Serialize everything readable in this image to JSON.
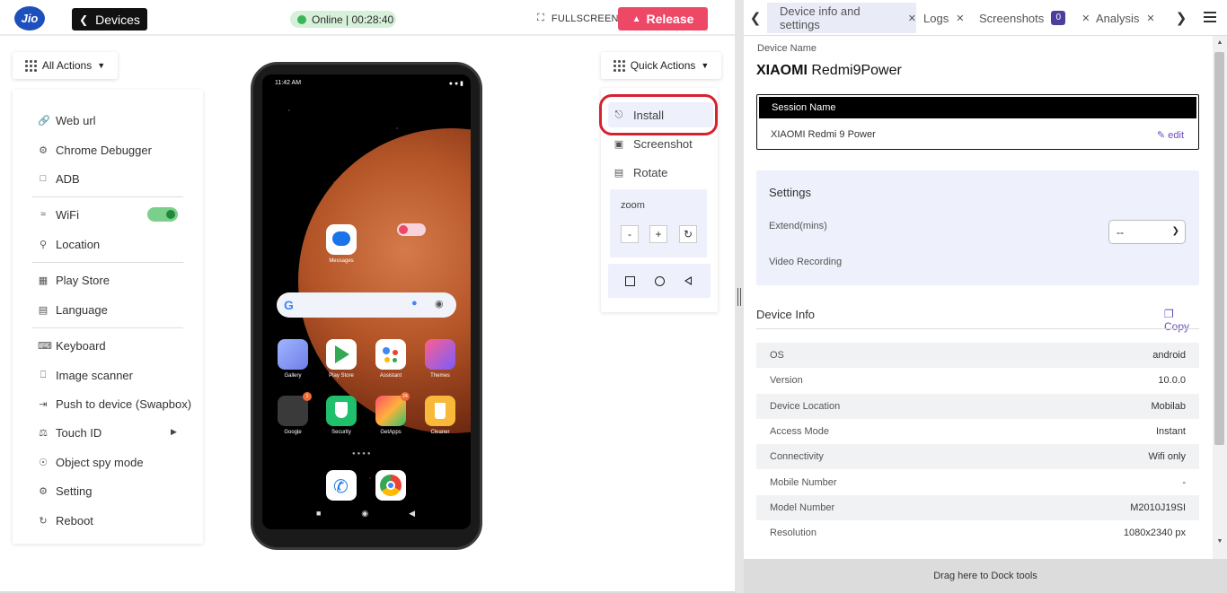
{
  "topbar": {
    "logo_text": "Jio",
    "devices_label": "Devices",
    "status": "Online | 00:28:40",
    "fullscreen_label": "FULLSCREEN",
    "release_label": "Release"
  },
  "all_actions": {
    "label": "All Actions",
    "items": [
      {
        "label": "Web url",
        "icon": "link-icon"
      },
      {
        "label": "Chrome Debugger",
        "icon": "bug-icon"
      },
      {
        "label": "ADB",
        "icon": "terminal-icon"
      },
      {
        "label": "WiFi",
        "icon": "wifi-icon",
        "toggle": "on"
      },
      {
        "label": "Location",
        "icon": "location-pin-icon"
      },
      {
        "label": "Play Store",
        "icon": "grid-icon"
      },
      {
        "label": "Language",
        "icon": "language-icon"
      },
      {
        "label": "Keyboard",
        "icon": "keyboard-icon"
      },
      {
        "label": "Image scanner",
        "icon": "image-scanner-icon"
      },
      {
        "label": "Push to device (Swapbox)",
        "icon": "push-icon"
      },
      {
        "label": "Touch ID",
        "icon": "fingerprint-icon"
      },
      {
        "label": "Object spy mode",
        "icon": "spy-icon"
      },
      {
        "label": "Setting",
        "icon": "gear-icon"
      },
      {
        "label": "Reboot",
        "icon": "reboot-icon"
      }
    ]
  },
  "phone": {
    "time": "11:42 AM",
    "apps_top": [
      {
        "label": "Messages"
      }
    ],
    "apps_row1": [
      {
        "label": "Gallery",
        "color": "#7b8cf2"
      },
      {
        "label": "Play Store",
        "color": "#ffffff"
      },
      {
        "label": "Assistant",
        "color": "#ffffff"
      },
      {
        "label": "Themes",
        "color": "#f5447c"
      }
    ],
    "apps_row2": [
      {
        "label": "Google",
        "color": "#3a3a3a",
        "badge": "1"
      },
      {
        "label": "Security",
        "color": "#1fbf6b"
      },
      {
        "label": "GetApps",
        "color": "#f4583a",
        "badge": "24"
      },
      {
        "label": "Cleaner",
        "color": "#f8b93a"
      }
    ]
  },
  "quick_actions": {
    "label": "Quick Actions",
    "install": "Install",
    "screenshot": "Screenshot",
    "rotate": "Rotate",
    "zoom_label": "zoom",
    "zoom_minus": "-",
    "zoom_plus": "+"
  },
  "tabs": [
    {
      "label": "Device info and settings",
      "active": true
    },
    {
      "label": "Logs"
    },
    {
      "label": "Screenshots",
      "count": "0"
    },
    {
      "label": "Analysis"
    }
  ],
  "device": {
    "name_label": "Device Name",
    "brand": "XIAOMI",
    "model": "Redmi9Power",
    "session_label": "Session Name",
    "session_value": "XIAOMI Redmi 9 Power",
    "edit_label": "edit"
  },
  "settings": {
    "title": "Settings",
    "extend_label": "Extend(mins)",
    "extend_value": "--",
    "video_label": "Video Recording",
    "video_on": false
  },
  "device_info": {
    "title": "Device Info",
    "copy_label": "Copy",
    "rows": [
      {
        "key": "OS",
        "value": "android"
      },
      {
        "key": "Version",
        "value": "10.0.0"
      },
      {
        "key": "Device Location",
        "value": "Mobilab"
      },
      {
        "key": "Access Mode",
        "value": "Instant"
      },
      {
        "key": "Connectivity",
        "value": "Wifi only"
      },
      {
        "key": "Mobile Number",
        "value": "-"
      },
      {
        "key": "Model Number",
        "value": "M2010J19SI"
      },
      {
        "key": "Resolution",
        "value": "1080x2340 px"
      }
    ]
  },
  "dock_label": "Drag here to Dock tools",
  "colors": {
    "accent": "#ee4867",
    "purple": "#6a4bbd",
    "online_green": "#3cb55a",
    "highlight_red": "#d7212f"
  }
}
